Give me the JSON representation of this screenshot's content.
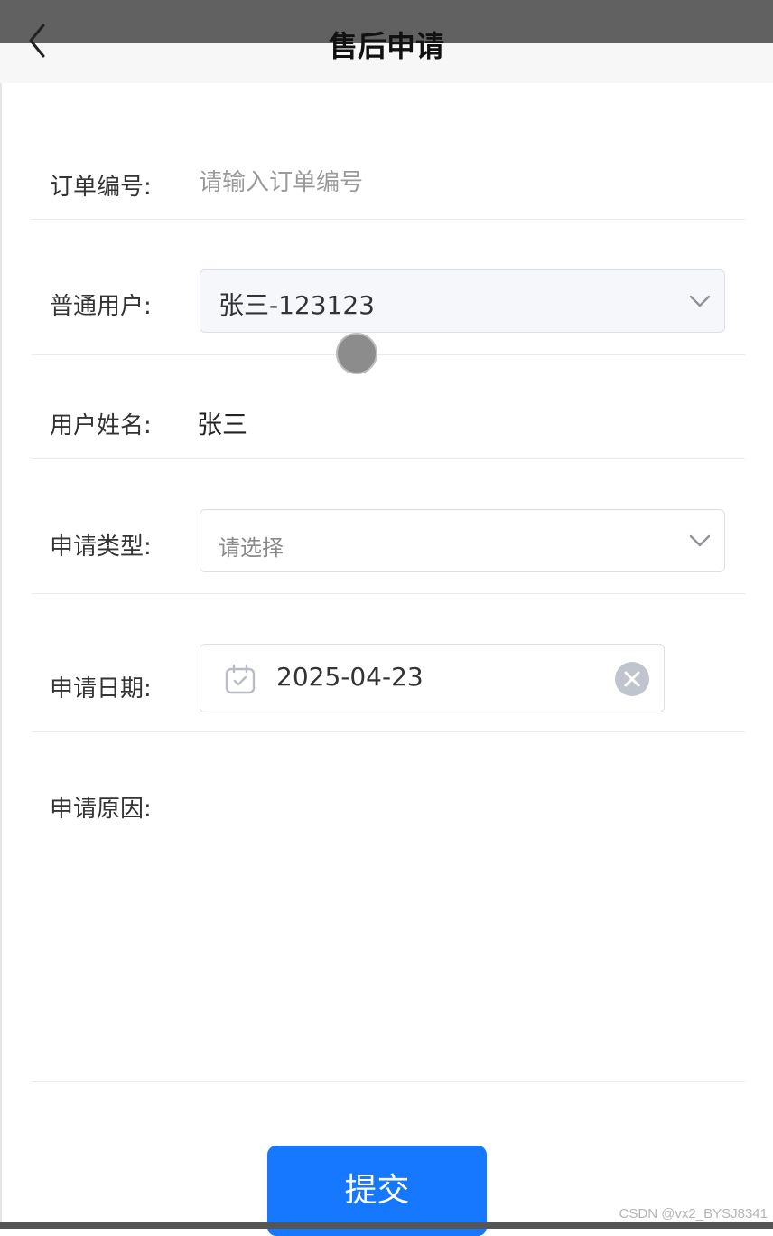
{
  "header": {
    "title": "售后申请",
    "back_icon": "chevron-left-icon"
  },
  "form": {
    "order_number": {
      "label": "订单编号:",
      "value": "",
      "placeholder": "请输入订单编号"
    },
    "user": {
      "label": "普通用户:",
      "selected": "张三-123123",
      "icon": "chevron-down-icon"
    },
    "user_name": {
      "label": "用户姓名:",
      "value": "张三"
    },
    "apply_type": {
      "label": "申请类型:",
      "placeholder": "请选择",
      "icon": "chevron-down-icon"
    },
    "apply_date": {
      "label": "申请日期:",
      "value": "2025-04-23",
      "icon": "calendar-icon",
      "clear_icon": "clear-icon"
    },
    "apply_reason": {
      "label": "申请原因:",
      "value": ""
    }
  },
  "submit_label": "提交",
  "watermark": "CSDN @vx2_BYSJ8341",
  "colors": {
    "primary": "#1677ff",
    "header_bg": "#f7f7f7",
    "status_bar": "#616161"
  }
}
